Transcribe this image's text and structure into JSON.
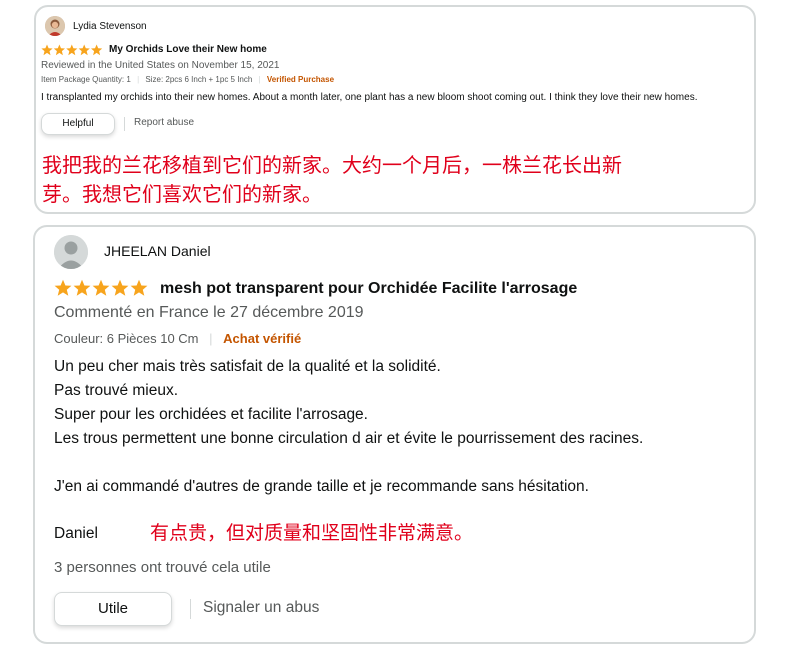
{
  "review1": {
    "reviewer": "Lydia Stevenson",
    "rating": 5,
    "title": "My Orchids Love their New home",
    "reviewed_in": "Reviewed in the United States on November 15, 2021",
    "item_qty": "Item Package Quantity: 1",
    "size": "Size: 2pcs 6 Inch + 1pc 5 Inch",
    "verified": "Verified Purchase",
    "body": "I transplanted my orchids into their new homes. About a month later, one plant has a new bloom shoot coming out. I think they love their new homes.",
    "helpful_label": "Helpful",
    "report_label": "Report abuse",
    "translation_line1": "我把我的兰花移植到它们的新家。大约一个月后，一株兰花长出新",
    "translation_line2": "芽。我想它们喜欢它们的新家。"
  },
  "review2": {
    "reviewer": "JHEELAN Daniel",
    "rating": 5,
    "title": "mesh pot transparent pour Orchidée Facilite l'arrosage",
    "reviewed_in": "Commenté en France le 27 décembre 2019",
    "color": "Couleur: 6 Pièces 10 Cm",
    "verified": "Achat vérifié",
    "body_lines": [
      "Un peu cher mais très satisfait de la qualité et la solidité.",
      "Pas trouvé mieux.",
      "Super pour les orchidées et facilite l'arrosage.",
      "Les trous permettent une bonne circulation d air et évite le pourrissement des racines.",
      "J'en ai commandé d'autres de grande taille et je recommande sans hésitation."
    ],
    "signature": "Daniel",
    "translation": "有点贵，但对质量和坚固性非常满意。",
    "helpful_count": "3 personnes ont trouvé cela utile",
    "helpful_label": "Utile",
    "report_label": "Signaler un abus"
  },
  "colors": {
    "star": "#f7a41d",
    "verified": "#c45500",
    "translation": "#e0001b",
    "border": "#d5d9d9"
  }
}
